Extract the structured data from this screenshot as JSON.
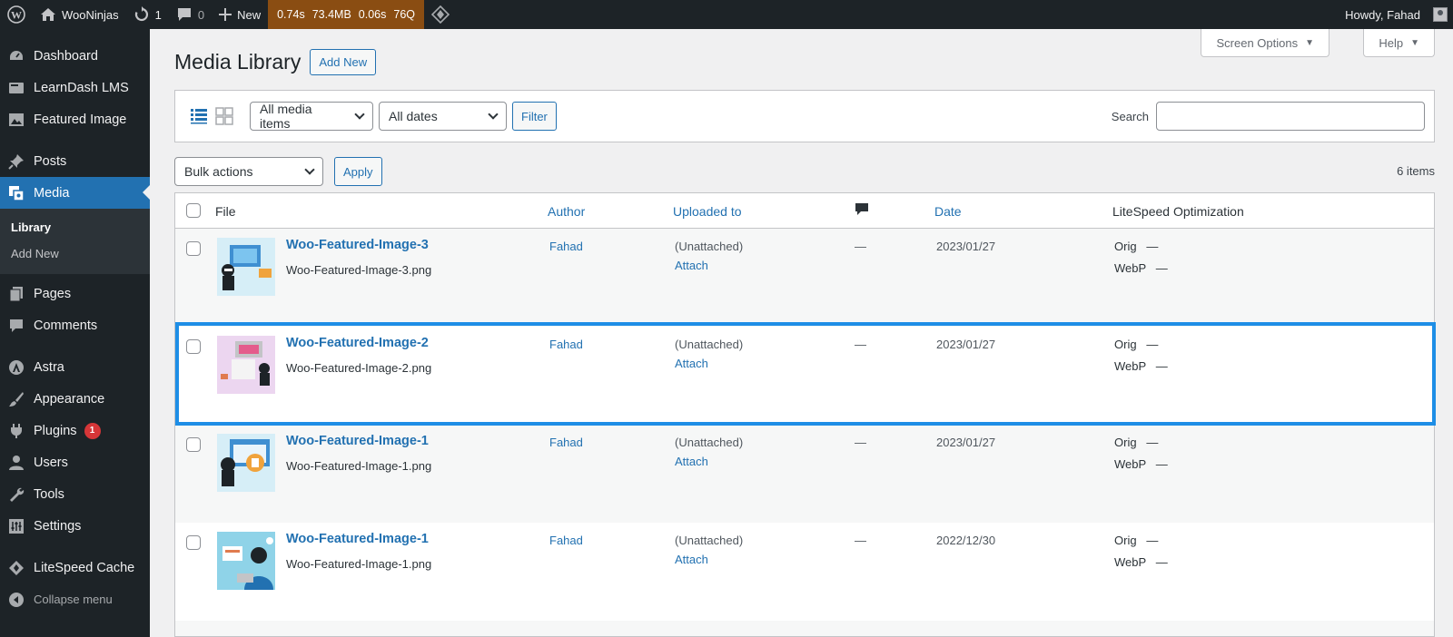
{
  "admin_bar": {
    "site_name": "WooNinjas",
    "updates_count": "1",
    "comments_count": "0",
    "new_label": "New",
    "perf": {
      "time1": "0.74s",
      "memory": "73.4MB",
      "time2": "0.06s",
      "queries": "76Q"
    },
    "greeting": "Howdy, Fahad"
  },
  "sidebar": {
    "items": [
      {
        "label": "Dashboard",
        "icon": "dashboard-icon"
      },
      {
        "label": "LearnDash LMS",
        "icon": "learndash-icon"
      },
      {
        "label": "Featured Image",
        "icon": "image-icon"
      },
      {
        "label": "Posts",
        "icon": "pin-icon"
      },
      {
        "label": "Media",
        "icon": "media-icon"
      },
      {
        "label": "Pages",
        "icon": "pages-icon"
      },
      {
        "label": "Comments",
        "icon": "comments-icon"
      },
      {
        "label": "Astra",
        "icon": "astra-icon"
      },
      {
        "label": "Appearance",
        "icon": "brush-icon"
      },
      {
        "label": "Plugins",
        "icon": "plugin-icon",
        "badge": "1"
      },
      {
        "label": "Users",
        "icon": "user-icon"
      },
      {
        "label": "Tools",
        "icon": "wrench-icon"
      },
      {
        "label": "Settings",
        "icon": "settings-icon"
      },
      {
        "label": "LiteSpeed Cache",
        "icon": "litespeed-icon"
      }
    ],
    "submenu": [
      "Library",
      "Add New"
    ],
    "collapse": "Collapse menu"
  },
  "top_buttons": {
    "screen_options": "Screen Options",
    "help": "Help"
  },
  "page": {
    "title": "Media Library",
    "add_new": "Add New"
  },
  "filters": {
    "media_type": "All media items",
    "dates": "All dates",
    "filter_button": "Filter",
    "search_label": "Search",
    "search_value": ""
  },
  "bulk": {
    "actions": "Bulk actions",
    "apply": "Apply",
    "items_count": "6 items"
  },
  "table": {
    "headers": {
      "file": "File",
      "author": "Author",
      "uploaded_to": "Uploaded to",
      "date": "Date",
      "litespeed": "LiteSpeed Optimization"
    },
    "rows": [
      {
        "title": "Woo-Featured-Image-3",
        "filename": "Woo-Featured-Image-3.png",
        "author": "Fahad",
        "uploaded": "(Unattached)",
        "attach": "Attach",
        "comments": "—",
        "date": "2023/01/27",
        "orig": "Orig   —",
        "webp": "WebP   —"
      },
      {
        "title": "Woo-Featured-Image-2",
        "filename": "Woo-Featured-Image-2.png",
        "author": "Fahad",
        "uploaded": "(Unattached)",
        "attach": "Attach",
        "comments": "—",
        "date": "2023/01/27",
        "orig": "Orig   —",
        "webp": "WebP   —"
      },
      {
        "title": "Woo-Featured-Image-1",
        "filename": "Woo-Featured-Image-1.png",
        "author": "Fahad",
        "uploaded": "(Unattached)",
        "attach": "Attach",
        "comments": "—",
        "date": "2023/01/27",
        "orig": "Orig   —",
        "webp": "WebP   —"
      },
      {
        "title": "Woo-Featured-Image-1",
        "filename": "Woo-Featured-Image-1.png",
        "author": "Fahad",
        "uploaded": "(Unattached)",
        "attach": "Attach",
        "comments": "—",
        "date": "2022/12/30",
        "orig": "Orig   —",
        "webp": "WebP   —"
      }
    ]
  },
  "colors": {
    "admin_bar": "#1d2327",
    "accent": "#2271b1",
    "perf_bar": "#8a4d12",
    "highlight": "#1e8ee6",
    "badge": "#d63638"
  }
}
